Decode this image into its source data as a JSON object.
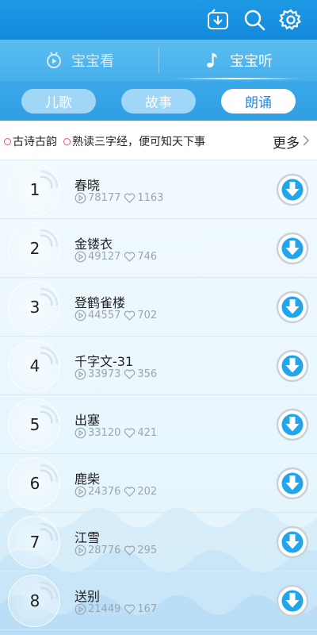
{
  "topbar": {
    "icons": [
      "download-box-icon",
      "search-icon",
      "gear-icon"
    ],
    "color": "#1e9ae6"
  },
  "modes": [
    {
      "label": "宝宝看",
      "icon": "tv-icon",
      "active": false
    },
    {
      "label": "宝宝听",
      "icon": "music-note-icon",
      "active": true
    }
  ],
  "tabs": [
    {
      "label": "儿歌",
      "active": false
    },
    {
      "label": "故事",
      "active": false
    },
    {
      "label": "朗诵",
      "active": true
    }
  ],
  "marquee": {
    "tags": [
      "古诗古韵",
      "熟读三字经，便可知天下事"
    ],
    "more_label": "更多"
  },
  "list": [
    {
      "rank": "1",
      "title": "春晓",
      "plays": "78177",
      "likes": "1163"
    },
    {
      "rank": "2",
      "title": "金镂衣",
      "plays": "49127",
      "likes": "746"
    },
    {
      "rank": "3",
      "title": "登鹤雀楼",
      "plays": "44557",
      "likes": "702"
    },
    {
      "rank": "4",
      "title": "千字文-31",
      "plays": "33973",
      "likes": "356"
    },
    {
      "rank": "5",
      "title": "出塞",
      "plays": "33120",
      "likes": "421"
    },
    {
      "rank": "6",
      "title": "鹿柴",
      "plays": "24376",
      "likes": "202"
    },
    {
      "rank": "7",
      "title": "江雪",
      "plays": "28776",
      "likes": "295"
    },
    {
      "rank": "8",
      "title": "送别",
      "plays": "21449",
      "likes": "167"
    }
  ],
  "colors": {
    "accent": "#1d8fe0",
    "download": "#21a5ec",
    "tag_dot": "#f0506e"
  }
}
